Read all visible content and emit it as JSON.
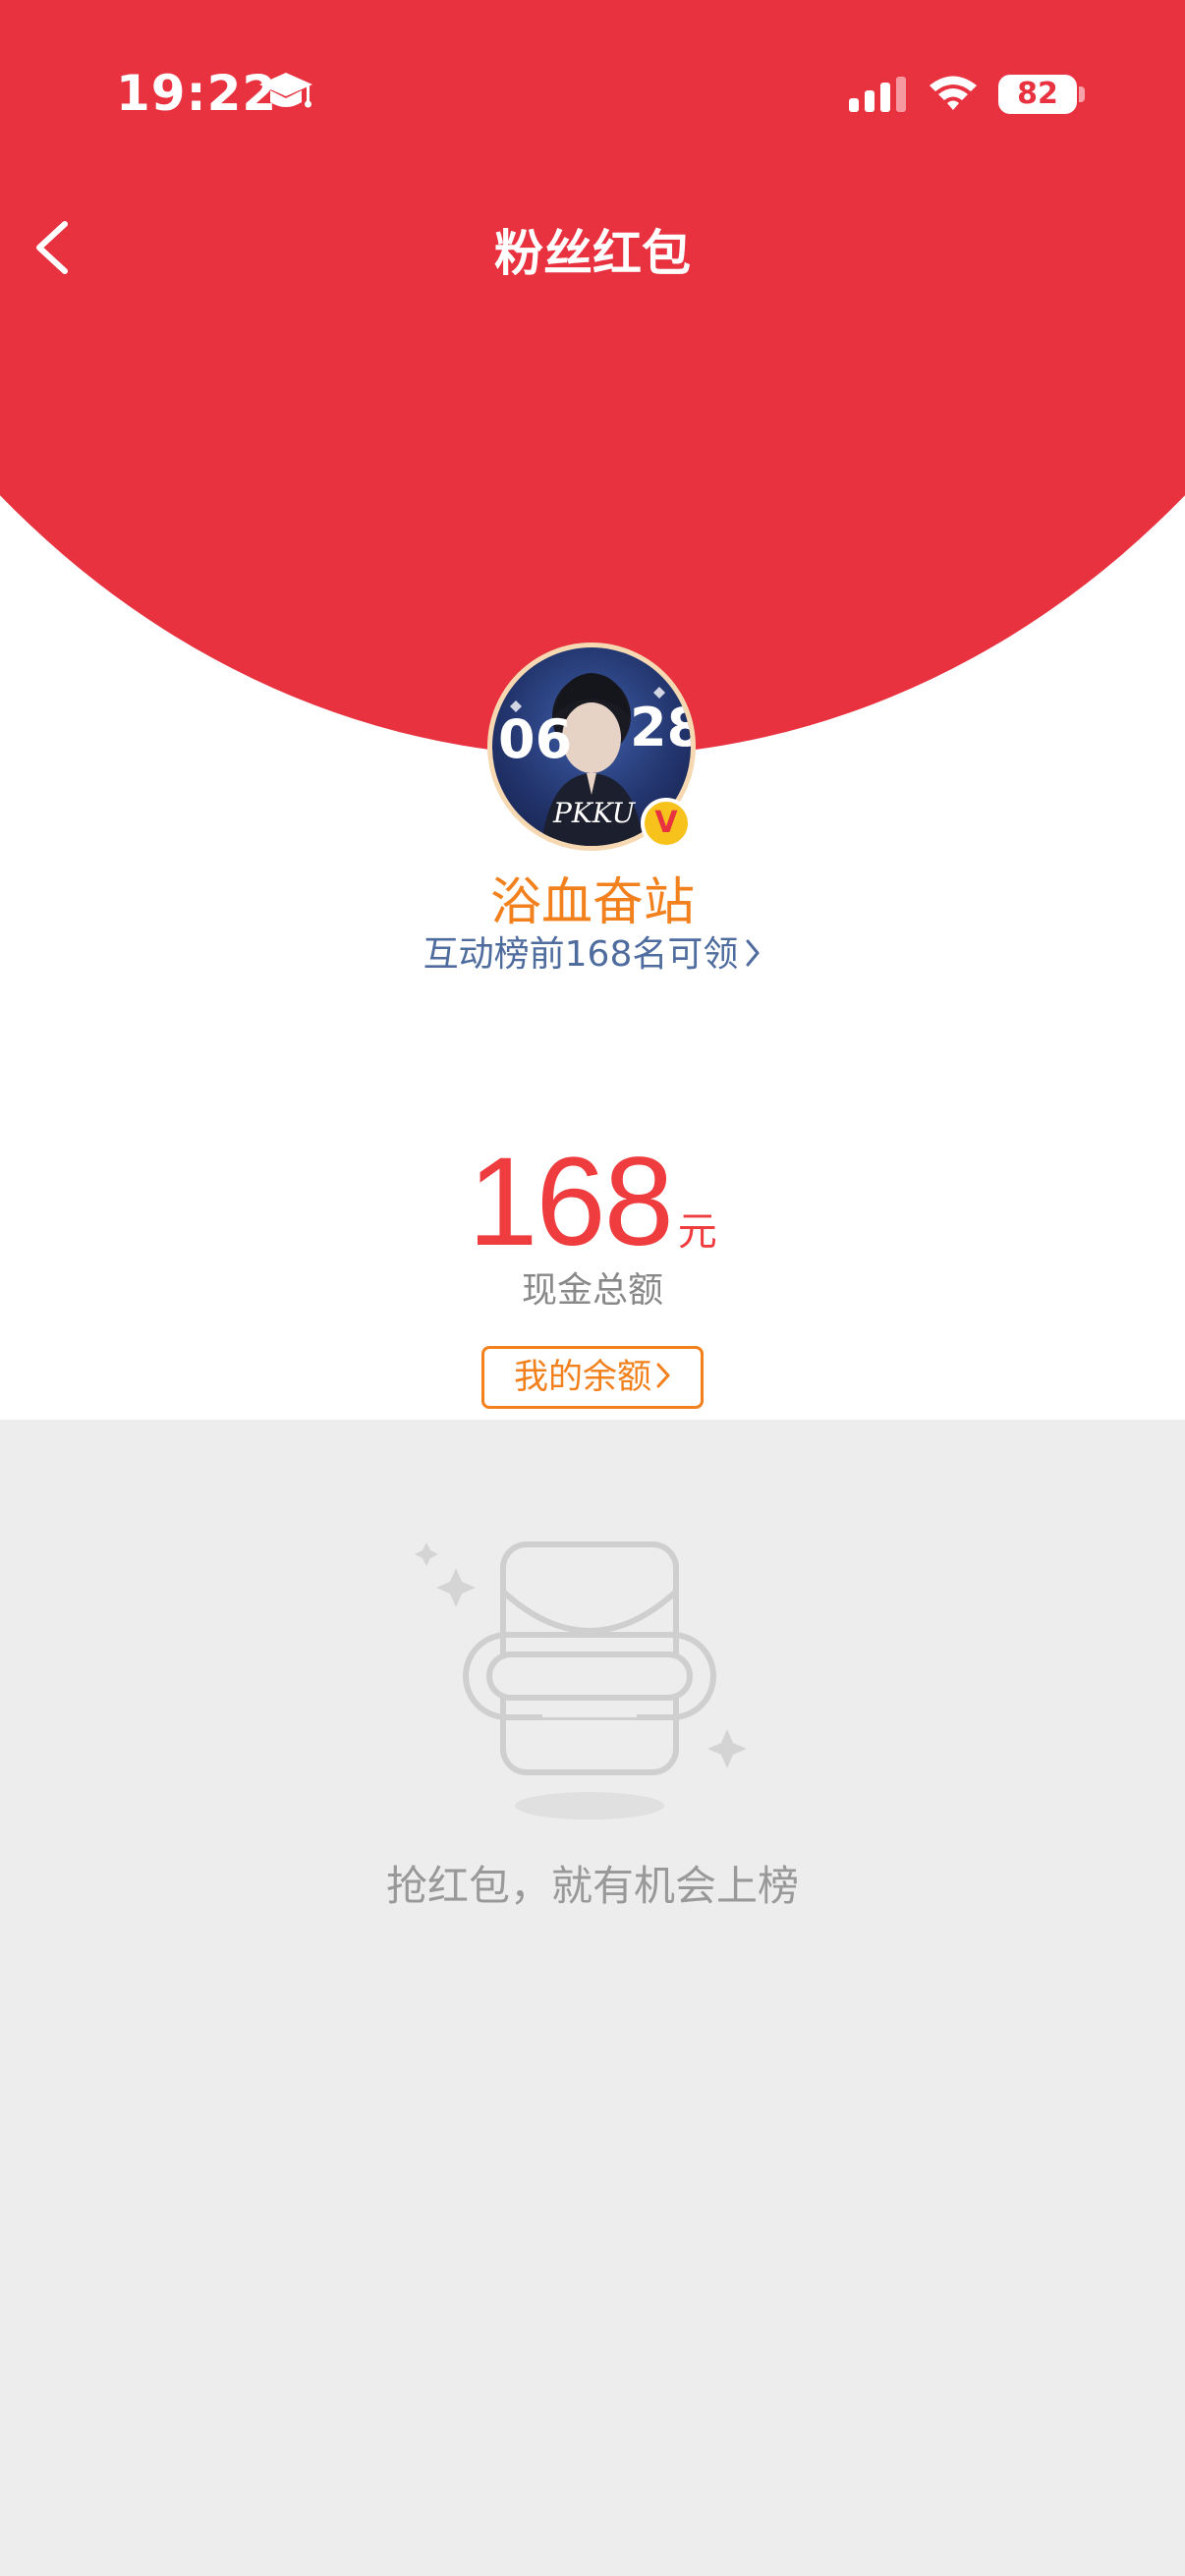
{
  "status_bar": {
    "time": "19:22",
    "battery": "82"
  },
  "nav": {
    "title": "粉丝红包"
  },
  "host": {
    "name": "浴血奋站",
    "rank_text": "互动榜前168名可领"
  },
  "red_packet": {
    "amount": "168",
    "unit": "元",
    "caption": "现金总额",
    "balance_label": "我的余额"
  },
  "empty_state": {
    "message": "抢红包，就有机会上榜"
  },
  "avatar_overlay": {
    "left_text": "06",
    "right_text": "28",
    "bottom_text": "PKKU"
  },
  "colors": {
    "red": "#e9323f",
    "orange": "#f2801d",
    "link_blue": "#4e6c9e",
    "gray_bg": "#ededed"
  }
}
